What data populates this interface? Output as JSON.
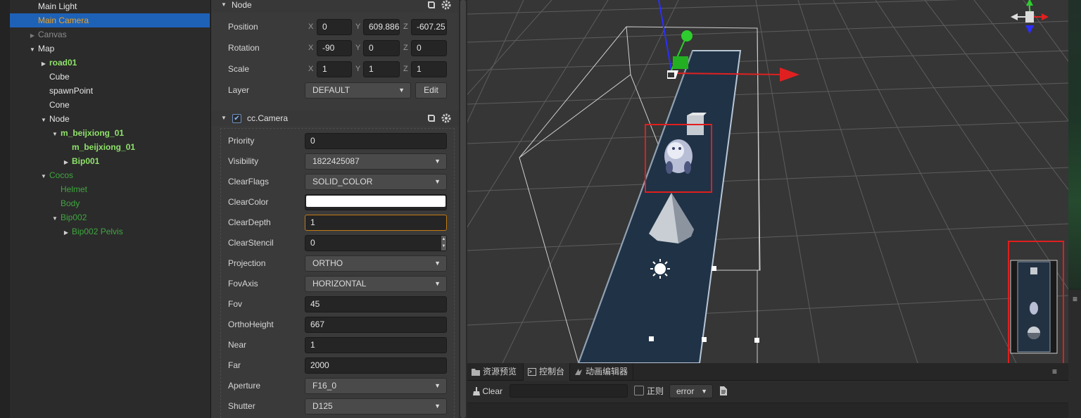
{
  "hierarchy": {
    "items": [
      {
        "label": "Main Light",
        "color": "#e6e6e6",
        "twisty": ""
      },
      {
        "label": "Main Camera",
        "color": "#f0a11c",
        "twisty": "",
        "selected": true
      },
      {
        "label": "Canvas",
        "color": "#8c8c8c",
        "twisty": "▶"
      },
      {
        "label": "Map",
        "color": "#e6e6e6",
        "twisty": "▼"
      },
      {
        "label": "road01",
        "color": "#8fe36a",
        "twisty": "▶"
      },
      {
        "label": "Cube",
        "color": "#e6e6e6",
        "twisty": ""
      },
      {
        "label": "spawnPoint",
        "color": "#e6e6e6",
        "twisty": ""
      },
      {
        "label": "Cone",
        "color": "#e6e6e6",
        "twisty": ""
      },
      {
        "label": "Node",
        "color": "#e6e6e6",
        "twisty": "▼"
      },
      {
        "label": "m_beijxiong_01",
        "color": "#8fe36a",
        "twisty": "▼"
      },
      {
        "label": "m_beijxiong_01",
        "color": "#8fe36a",
        "twisty": ""
      },
      {
        "label": "Bip001",
        "color": "#8fe36a",
        "twisty": "▶"
      },
      {
        "label": "Cocos",
        "color": "#3fa63f",
        "twisty": "▼"
      },
      {
        "label": "Helmet",
        "color": "#3fa63f",
        "twisty": ""
      },
      {
        "label": "Body",
        "color": "#3fa63f",
        "twisty": ""
      },
      {
        "label": "Bip002",
        "color": "#3fa63f",
        "twisty": "▼"
      },
      {
        "label": "Bip002 Pelvis",
        "color": "#3fa63f",
        "twisty": "▶"
      }
    ]
  },
  "inspector": {
    "node": {
      "title": "Node",
      "position": {
        "label": "Position",
        "x": "0",
        "y": "609.886",
        "z": "-607.25"
      },
      "rotation": {
        "label": "Rotation",
        "x": "-90",
        "y": "0",
        "z": "0"
      },
      "scale": {
        "label": "Scale",
        "x": "1",
        "y": "1",
        "z": "1"
      },
      "layer": {
        "label": "Layer",
        "value": "DEFAULT",
        "edit": "Edit"
      },
      "axes": {
        "x": "X",
        "y": "Y",
        "z": "Z"
      }
    },
    "camera": {
      "title": "cc.Camera",
      "enabled": true,
      "priority": {
        "label": "Priority",
        "value": "0"
      },
      "visibility": {
        "label": "Visibility",
        "value": "1822425087"
      },
      "clear_flags": {
        "label": "ClearFlags",
        "value": "SOLID_COLOR"
      },
      "clear_color": {
        "label": "ClearColor",
        "value": "#ffffff"
      },
      "clear_depth": {
        "label": "ClearDepth",
        "value": "1"
      },
      "clear_stencil": {
        "label": "ClearStencil",
        "value": "0"
      },
      "projection": {
        "label": "Projection",
        "value": "ORTHO"
      },
      "fov_axis": {
        "label": "FovAxis",
        "value": "HORIZONTAL"
      },
      "fov": {
        "label": "Fov",
        "value": "45"
      },
      "ortho_height": {
        "label": "OrthoHeight",
        "value": "667"
      },
      "near": {
        "label": "Near",
        "value": "1"
      },
      "far": {
        "label": "Far",
        "value": "2000"
      },
      "aperture": {
        "label": "Aperture",
        "value": "F16_0"
      },
      "shutter": {
        "label": "Shutter",
        "value": "D125"
      }
    }
  },
  "bottom_panel": {
    "tabs": [
      {
        "label": "资源预览",
        "icon": "folder-icon"
      },
      {
        "label": "控制台",
        "icon": "console-icon",
        "active": true
      },
      {
        "label": "动画编辑器",
        "icon": "animation-icon"
      }
    ],
    "clear_label": "Clear",
    "regex_label": "正则",
    "level_value": "error"
  },
  "colors": {
    "selection": "#1e62b8",
    "highlight": "#e01e1e",
    "gizmo_x": "#e02020",
    "gizmo_y": "#2ecc2e",
    "gizmo_z": "#2d2dff"
  }
}
